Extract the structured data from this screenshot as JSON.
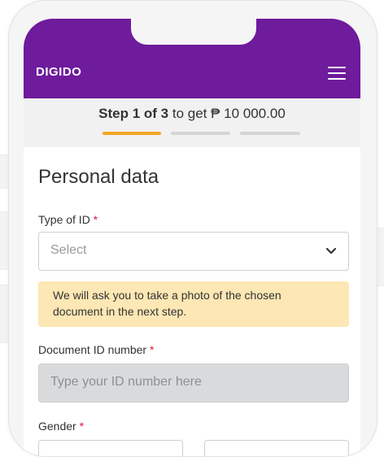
{
  "header": {
    "logo": "DIGIDO",
    "menu_icon": "hamburger-menu-icon"
  },
  "stepper": {
    "current": "Step 1 of 3",
    "suffix": " to get ₱ 10 000.00",
    "steps_total": 3,
    "steps_done": 1
  },
  "form": {
    "title": "Personal data",
    "required_mark": "*",
    "id_type": {
      "label": "Type of ID",
      "placeholder": "Select"
    },
    "info": "We will ask you to take a photo of the chosen document in the next step.",
    "document_number": {
      "label": "Document ID number",
      "placeholder": "Type your ID number here"
    },
    "gender": {
      "label": "Gender"
    }
  },
  "colors": {
    "brand": "#6e1b9c",
    "accent": "#f5a623",
    "info_bg": "#fde7b4",
    "required": "#e0183a"
  }
}
